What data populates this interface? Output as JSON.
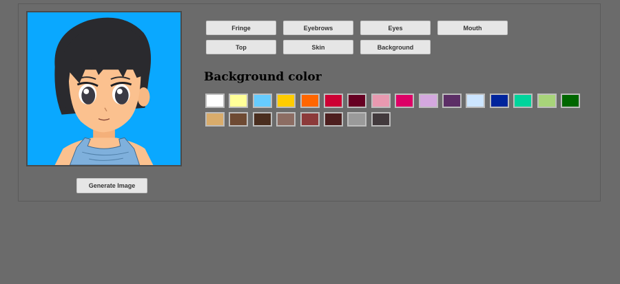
{
  "tabs": [
    "Fringe",
    "Eyebrows",
    "Eyes",
    "Mouth",
    "Top",
    "Skin",
    "Background"
  ],
  "section_title": "Background color",
  "generate_label": "Generate Image",
  "preview": {
    "background": "#0aa8ff",
    "skin": "#fbc18f",
    "hair": "#2a2a2e",
    "top": "#7fb0dc"
  },
  "swatches": [
    "#ffffff",
    "#ffff99",
    "#66ccff",
    "#ffcc00",
    "#ff6600",
    "#cc0033",
    "#660022",
    "#e899b0",
    "#dd0066",
    "#d4a8df",
    "#5c2e66",
    "#cce5ff",
    "#00249c",
    "#00d49c",
    "#a8d47a",
    "#006600",
    "#d9ac6b",
    "#6e4a33",
    "#4a2e1f",
    "#8c6d63",
    "#8c3a3a",
    "#4d1f1f",
    "#9a9a9a",
    "#423a3d"
  ]
}
